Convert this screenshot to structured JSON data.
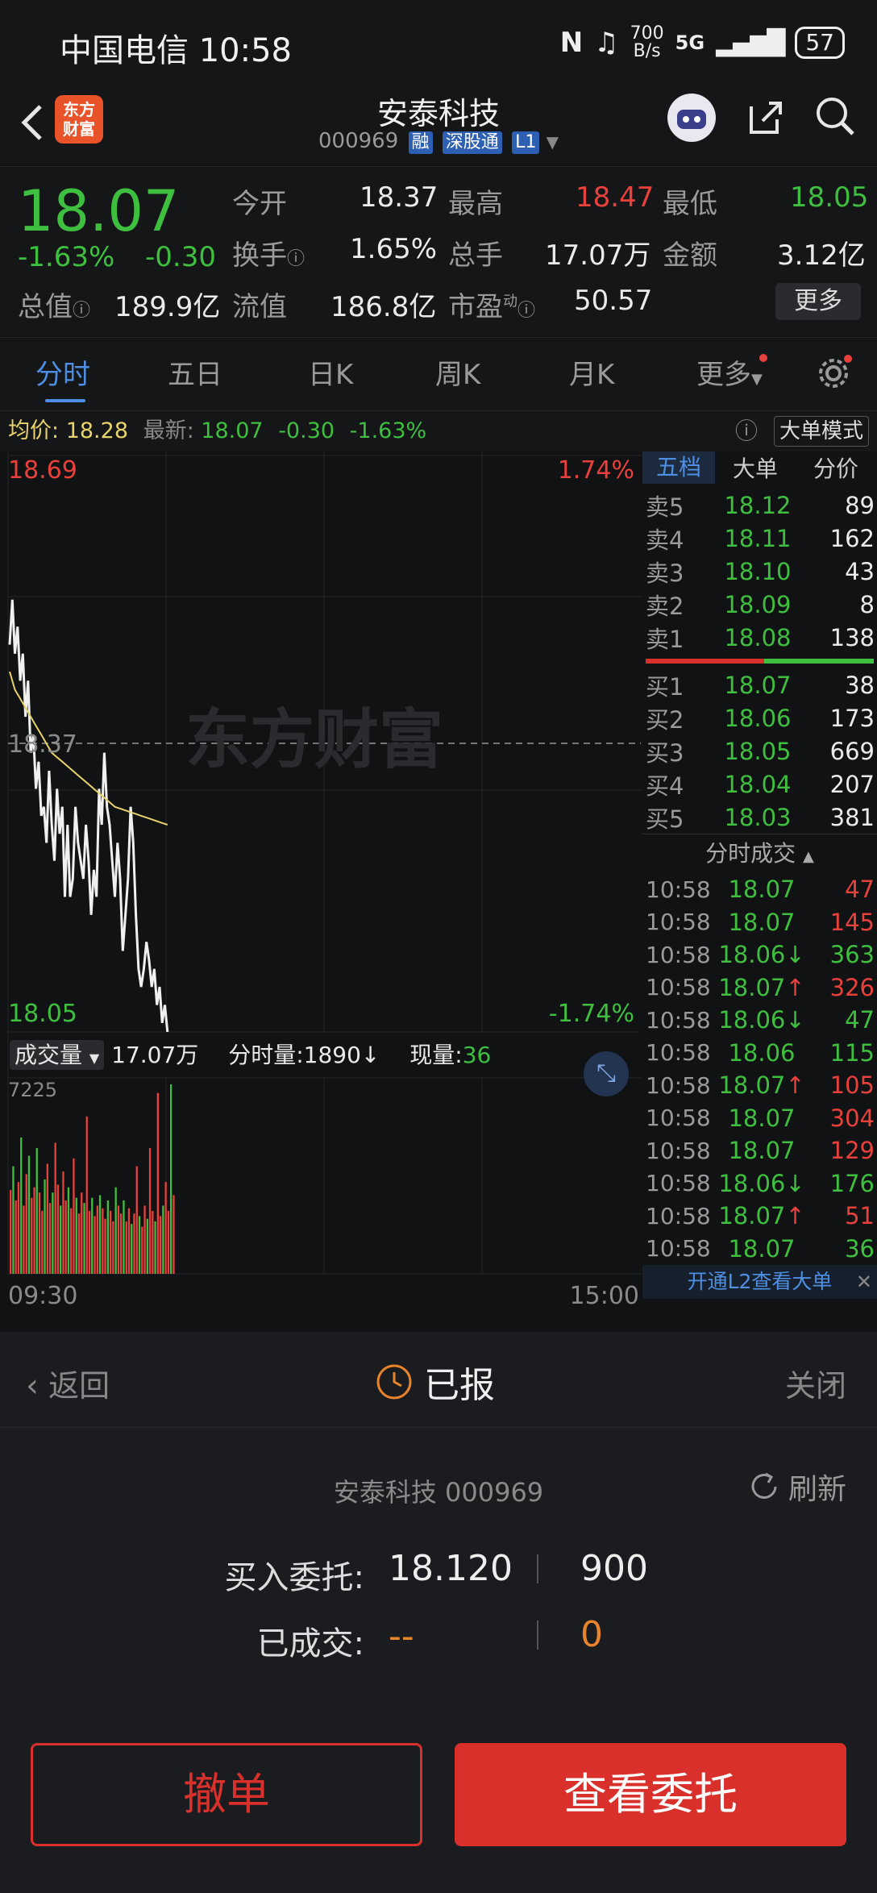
{
  "status_bar": {
    "carrier_time": "中国电信 10:58",
    "speed_top": "700",
    "speed_bottom": "B/s",
    "network": "5G",
    "battery": "57"
  },
  "header": {
    "title": "安泰科技",
    "code": "000969",
    "tags": [
      "融",
      "深股通",
      "L1"
    ],
    "logo_line1": "东方",
    "logo_line2": "财富"
  },
  "quote": {
    "price": "18.07",
    "change_pct": "-1.63%",
    "change": "-0.30",
    "open_label": "今开",
    "open": "18.37",
    "high_label": "最高",
    "high": "18.47",
    "low_label": "最低",
    "low": "18.05",
    "turnover_label": "换手",
    "turnover": "1.65%",
    "volume_label": "总手",
    "volume": "17.07万",
    "amount_label": "金额",
    "amount": "3.12亿",
    "mktcap_label": "总值",
    "mktcap": "189.9亿",
    "float_label": "流值",
    "float": "186.8亿",
    "pe_label": "市盈",
    "pe_super": "动",
    "pe": "50.57",
    "more_label": "更多"
  },
  "tabs": [
    "分时",
    "五日",
    "日K",
    "周K",
    "月K",
    "更多"
  ],
  "avg_info": {
    "avg_label": "均价:",
    "avg": "18.28",
    "latest_label": "最新:",
    "latest": "18.07",
    "chg": "-0.30",
    "pct": "-1.63%",
    "mode_label": "大单模式"
  },
  "chart_data": {
    "type": "line",
    "y_top": "18.69",
    "y_bottom": "18.05",
    "pct_top": "1.74%",
    "pct_bottom": "-1.74%",
    "ref_label": "18.37",
    "x_start": "09:30",
    "x_end": "15:00",
    "watermark": "东方财富",
    "ylim": [
      18.05,
      18.69
    ],
    "prev_close": 18.37,
    "series": [
      {
        "values": [
          18.48,
          18.53,
          18.47,
          18.5,
          18.44,
          18.47,
          18.4,
          18.44,
          18.36,
          18.38,
          18.32,
          18.35,
          18.29,
          18.3,
          18.26,
          18.34,
          18.28,
          18.24,
          18.32,
          18.27,
          18.3,
          18.2,
          18.28,
          18.2,
          18.22,
          18.3,
          18.26,
          18.24,
          18.22,
          18.28,
          18.24,
          18.18,
          18.23,
          18.2,
          18.32,
          18.28,
          18.36,
          18.3,
          18.28,
          18.24,
          18.2,
          18.26,
          18.22,
          18.14,
          18.18,
          18.22,
          18.3,
          18.26,
          18.18,
          18.12,
          18.1,
          18.12,
          18.15,
          18.13,
          18.1,
          18.12,
          18.08,
          18.1,
          18.06,
          18.08,
          18.05
        ]
      },
      {
        "values": [
          18.45,
          18.43,
          18.42,
          18.41,
          18.4,
          18.39,
          18.38,
          18.37,
          18.36,
          18.355,
          18.35,
          18.345,
          18.34,
          18.335,
          18.33,
          18.325,
          18.32,
          18.315,
          18.31,
          18.305,
          18.3,
          18.298,
          18.296,
          18.294,
          18.292,
          18.29,
          18.288,
          18.286,
          18.284,
          18.282,
          18.28
        ]
      }
    ],
    "volume": {
      "label": "成交量",
      "total": "17.07万",
      "tick_label": "分时量:1890",
      "now_label": "现量:",
      "now": "36",
      "max_tick": "7225",
      "bars": [
        3200,
        4100,
        2800,
        3500,
        5200,
        2600,
        3800,
        4500,
        2900,
        3300,
        4800,
        3100,
        2400,
        3600,
        4200,
        2700,
        3100,
        5000,
        3400,
        2600,
        3900,
        2800,
        3300,
        2500,
        4400,
        2900,
        2300,
        3100,
        2700,
        6000,
        2400,
        2900,
        2200,
        2600,
        3000,
        2500,
        2100,
        2800,
        2400,
        2000,
        3300,
        2600,
        2300,
        2800,
        2000,
        2500,
        1900,
        2300,
        4100,
        2200,
        1800,
        2600,
        2100,
        4800,
        2400,
        2000,
        6900,
        2200,
        2600,
        3500,
        2400,
        7225,
        3000
      ]
    }
  },
  "orderbook": {
    "tabs": [
      "五档",
      "大单",
      "分价"
    ],
    "asks": [
      {
        "label": "卖5",
        "price": "18.12",
        "vol": "89"
      },
      {
        "label": "卖4",
        "price": "18.11",
        "vol": "162"
      },
      {
        "label": "卖3",
        "price": "18.10",
        "vol": "43"
      },
      {
        "label": "卖2",
        "price": "18.09",
        "vol": "8"
      },
      {
        "label": "卖1",
        "price": "18.08",
        "vol": "138"
      }
    ],
    "bids": [
      {
        "label": "买1",
        "price": "18.07",
        "vol": "38"
      },
      {
        "label": "买2",
        "price": "18.06",
        "vol": "173"
      },
      {
        "label": "买3",
        "price": "18.05",
        "vol": "669"
      },
      {
        "label": "买4",
        "price": "18.04",
        "vol": "207"
      },
      {
        "label": "买5",
        "price": "18.03",
        "vol": "381"
      }
    ],
    "trades_title": "分时成交",
    "trades": [
      {
        "time": "10:58",
        "price": "18.07",
        "arrow": "",
        "vol": "47",
        "color": "red"
      },
      {
        "time": "10:58",
        "price": "18.07",
        "arrow": "",
        "vol": "145",
        "color": "red"
      },
      {
        "time": "10:58",
        "price": "18.06",
        "arrow": "↓",
        "vol": "363",
        "color": "green"
      },
      {
        "time": "10:58",
        "price": "18.07",
        "arrow": "↑",
        "vol": "326",
        "color": "red"
      },
      {
        "time": "10:58",
        "price": "18.06",
        "arrow": "↓",
        "vol": "47",
        "color": "green"
      },
      {
        "time": "10:58",
        "price": "18.06",
        "arrow": "",
        "vol": "115",
        "color": "green"
      },
      {
        "time": "10:58",
        "price": "18.07",
        "arrow": "↑",
        "vol": "105",
        "color": "red"
      },
      {
        "time": "10:58",
        "price": "18.07",
        "arrow": "",
        "vol": "304",
        "color": "red"
      },
      {
        "time": "10:58",
        "price": "18.07",
        "arrow": "",
        "vol": "129",
        "color": "red"
      },
      {
        "time": "10:58",
        "price": "18.06",
        "arrow": "↓",
        "vol": "176",
        "color": "green"
      },
      {
        "time": "10:58",
        "price": "18.07",
        "arrow": "↑",
        "vol": "51",
        "color": "red"
      },
      {
        "time": "10:58",
        "price": "18.07",
        "arrow": "",
        "vol": "36",
        "color": "green"
      }
    ],
    "l2_link": "开通L2查看大单"
  },
  "panel": {
    "back_label": "返回",
    "status": "已报",
    "close_label": "关闭",
    "stock_line": "安泰科技 000969",
    "refresh_label": "刷新",
    "buy_label": "买入委托:",
    "buy_price": "18.120",
    "buy_qty": "900",
    "filled_label": "已成交:",
    "filled_price": "--",
    "filled_qty": "0",
    "cancel_label": "撤单",
    "view_label": "查看委托"
  },
  "colors": {
    "up": "#e8413c",
    "down": "#3fbf3f",
    "accent": "#4e8fe3",
    "button_red": "#d9302b"
  }
}
